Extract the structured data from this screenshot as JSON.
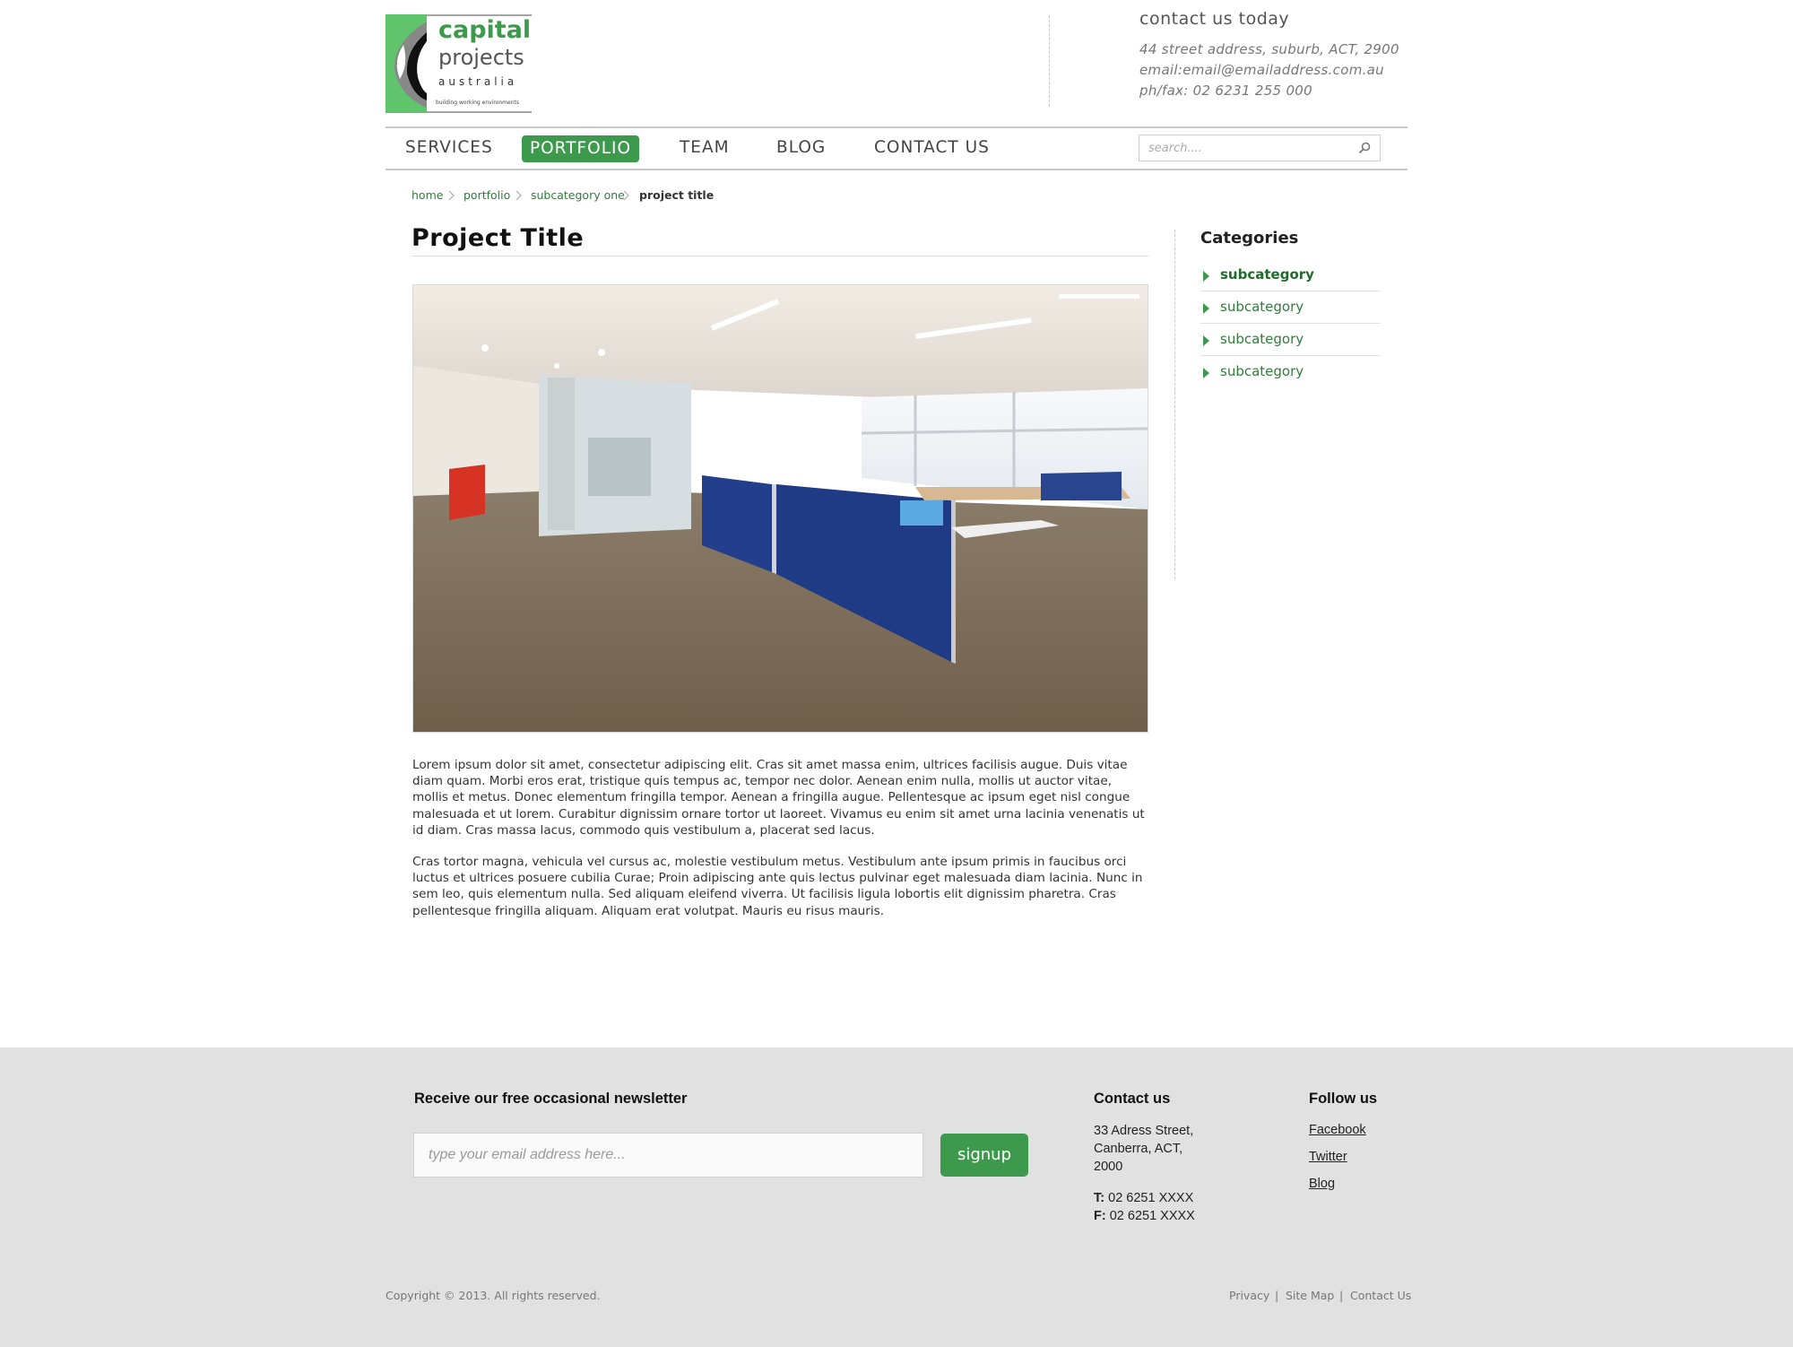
{
  "brand": {
    "name_line1": "capital",
    "name_line2": "projects",
    "name_line3": "australia",
    "tagline": "building working environments",
    "accent": "#3d9a4d"
  },
  "header": {
    "contact_title": "contact us today",
    "address": "44 street address, suburb, ACT, 2900",
    "email": "email:email@emailaddress.com.au",
    "phone": "ph/fax: 02 6231 255 000"
  },
  "nav": {
    "items": [
      {
        "label": "SERVICES"
      },
      {
        "label": "PORTFOLIO",
        "active": true
      },
      {
        "label": "TEAM"
      },
      {
        "label": "BLOG"
      },
      {
        "label": "CONTACT US"
      }
    ],
    "search_placeholder": "search...."
  },
  "breadcrumb": [
    "home",
    "portfolio",
    "subcategory one",
    "project title"
  ],
  "main": {
    "title": "Project Title",
    "paragraphs": [
      "Lorem ipsum dolor sit amet, consectetur adipiscing elit. Cras sit amet massa enim, ultrices facilisis augue. Duis vitae diam quam. Morbi eros erat, tristique quis tempus ac, tempor nec dolor. Aenean enim nulla, mollis ut auctor vitae, mollis et metus. Donec elementum fringilla tempor. Aenean a fringilla augue. Pellentesque ac ipsum eget nisl congue malesuada et ut lorem. Curabitur dignissim ornare tortor ut laoreet. Vivamus eu enim sit amet urna lacinia venenatis ut id diam. Cras massa lacus, commodo quis vestibulum a, placerat sed lacus.",
      "Cras tortor magna, vehicula vel cursus ac, molestie vestibulum metus. Vestibulum ante ipsum primis in faucibus orci luctus et ultrices posuere cubilia Curae; Proin adipiscing ante quis lectus pulvinar eget malesuada diam lacinia. Nunc in sem leo, quis elementum nulla. Sed aliquam eleifend viverra. Ut facilisis ligula lobortis elit dignissim pharetra. Cras pellentesque fringilla aliquam. Aliquam erat volutpat. Mauris eu risus mauris."
    ]
  },
  "sidebar": {
    "title": "Categories",
    "items": [
      {
        "label": "subcategory",
        "active": true
      },
      {
        "label": "subcategory"
      },
      {
        "label": "subcategory"
      },
      {
        "label": "subcategory"
      }
    ]
  },
  "footer": {
    "newsletter_title": "Receive our free occasional newsletter",
    "email_placeholder": "type your email address here...",
    "signup_label": "signup",
    "contact_title": "Contact us",
    "address_lines": [
      "33 Adress Street,",
      "Canberra, ACT,",
      "2000"
    ],
    "phone_label": "T:",
    "phone": "02 6251 XXXX",
    "fax_label": "F:",
    "fax": "02 6251 XXXX",
    "follow_title": "Follow us",
    "social": [
      "Facebook",
      "Twitter",
      "Blog"
    ],
    "copyright": "Copyright © 2013. All rights reserved.",
    "legal": [
      "Privacy",
      "Site Map",
      "Contact Us"
    ],
    "legal_separator": "|"
  }
}
